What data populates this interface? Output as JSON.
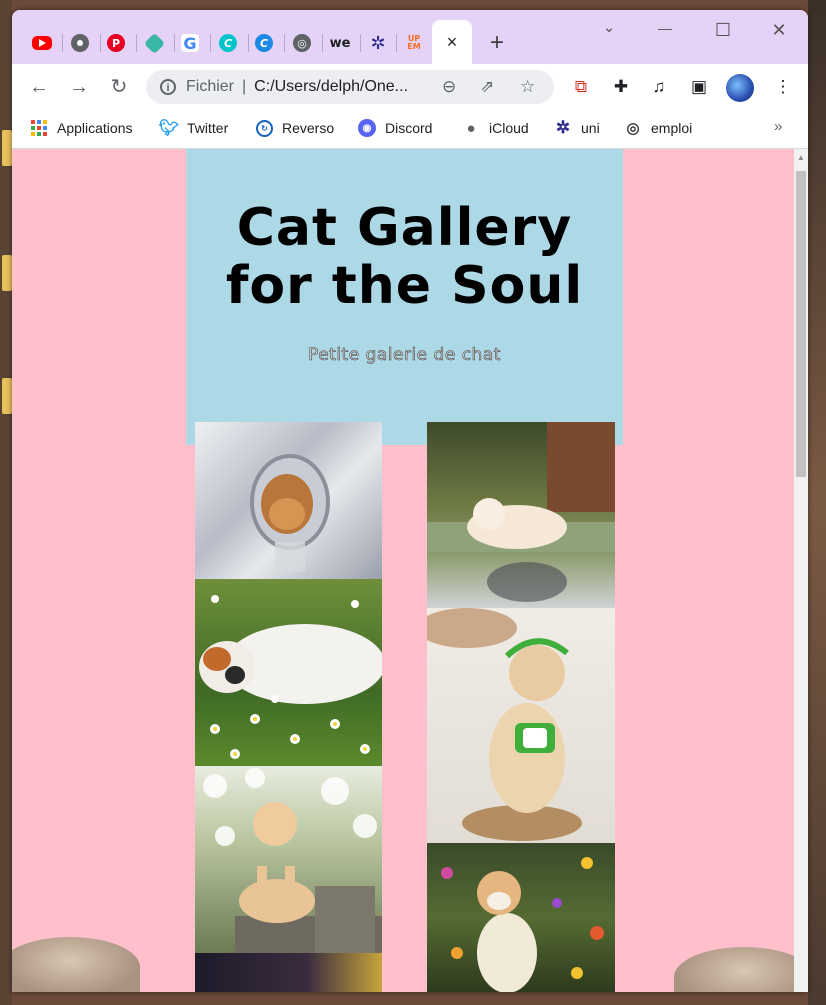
{
  "browser": {
    "tabs": [
      {
        "icon": "youtube-icon",
        "color": "#ff0000"
      },
      {
        "icon": "chrome-icon",
        "color": "#5f6368"
      },
      {
        "icon": "pinterest-icon",
        "color": "#e60023"
      },
      {
        "icon": "tag-icon",
        "color": "#3ab6a4"
      },
      {
        "icon": "google-icon",
        "color": "#4285f4"
      },
      {
        "icon": "canva-icon",
        "color": "#00c4cc"
      },
      {
        "icon": "canva-icon",
        "color": "#1e88e5"
      },
      {
        "icon": "globe-icon",
        "color": "#5f6368"
      },
      {
        "icon": "we-icon",
        "label": "we",
        "color": "#202124"
      },
      {
        "icon": "uni-icon",
        "color": "#2b2c8a"
      },
      {
        "icon": "upem-icon",
        "label": "UP EM",
        "color": "#f36f21"
      }
    ],
    "active_tab_close": "×",
    "new_tab": "+",
    "window_controls": {
      "dropdown": "⌄",
      "minimize": "—",
      "maximize": "☐",
      "close": "✕"
    },
    "address": {
      "prefix": "Fichier",
      "separator": "|",
      "url": "C:/Users/delph/One..."
    },
    "bookmarks": [
      {
        "label": "Applications",
        "icon": "apps-grid-icon"
      },
      {
        "label": "Twitter",
        "icon": "twitter-icon"
      },
      {
        "label": "Reverso",
        "icon": "reverso-icon"
      },
      {
        "label": "Discord",
        "icon": "discord-icon"
      },
      {
        "label": "iCloud",
        "icon": "apple-icon"
      },
      {
        "label": "uni",
        "icon": "uni-icon"
      },
      {
        "label": "emploi",
        "icon": "globe-icon"
      }
    ],
    "bookmarks_more": "»"
  },
  "page": {
    "title_line1": "Cat Gallery",
    "title_line2": "for the Soul",
    "subtitle": "Petite galerie de chat",
    "colors": {
      "background": "#ffc0cb",
      "header": "#add8e6"
    },
    "photos_left": [
      "cat-in-mirror-photo",
      "calico-cat-in-daisies-photo",
      "cat-on-fence-blossoms-photo",
      "dark-photo-partial"
    ],
    "photos_right": [
      "cat-sunbathing-photo",
      "cat-with-visor-photo",
      "cat-in-flowers-photo"
    ]
  }
}
